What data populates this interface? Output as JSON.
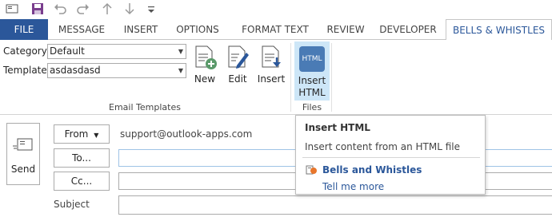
{
  "qat": {
    "icons": [
      "envelope-icon",
      "save-icon",
      "undo-icon",
      "redo-icon",
      "up-arrow-icon",
      "down-arrow-icon",
      "more-icon"
    ]
  },
  "tabs": [
    {
      "label": "FILE"
    },
    {
      "label": "MESSAGE"
    },
    {
      "label": "INSERT"
    },
    {
      "label": "OPTIONS"
    },
    {
      "label": "FORMAT TEXT"
    },
    {
      "label": "REVIEW"
    },
    {
      "label": "DEVELOPER"
    },
    {
      "label": "BELLS & WHISTLES"
    }
  ],
  "ribbon": {
    "category_label": "Category",
    "category_value": "Default",
    "template_label": "Template",
    "template_value": "asdasdasd",
    "new_label": "New",
    "edit_label": "Edit",
    "insert_label": "Insert",
    "insert_html_line1": "Insert",
    "insert_html_line2": "HTML",
    "html_icon_text": "HTML",
    "group_email_templates": "Email Templates",
    "group_files": "Files",
    "accent_color": "#2b579a",
    "highlight_color": "#cde6f7"
  },
  "compose": {
    "send_label": "Send",
    "from_label": "From",
    "from_value": "support@outlook-apps.com",
    "to_label": "To...",
    "cc_label": "Cc...",
    "subject_label": "Subject"
  },
  "tooltip": {
    "title": "Insert HTML",
    "description": "Insert content from an HTML file",
    "addin_name": "Bells and Whistles",
    "help_link": "Tell me more"
  }
}
